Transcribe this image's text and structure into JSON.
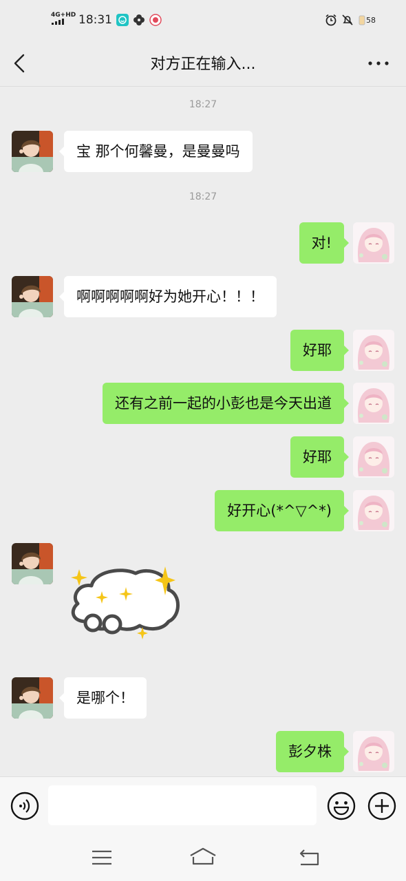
{
  "status_bar": {
    "network": "4G+HD",
    "time": "18:31",
    "battery": "58"
  },
  "header": {
    "title": "对方正在输入..."
  },
  "messages": [
    {
      "type": "time",
      "text": "18:27"
    },
    {
      "type": "text",
      "side": "in",
      "text": "宝 那个何馨曼，是曼曼吗"
    },
    {
      "type": "time",
      "text": "18:27"
    },
    {
      "type": "text",
      "side": "out",
      "text": "对!"
    },
    {
      "type": "text",
      "side": "in",
      "text": "啊啊啊啊啊好为她开心！！！"
    },
    {
      "type": "text",
      "side": "out",
      "text": "好耶"
    },
    {
      "type": "text",
      "side": "out",
      "text": "还有之前一起的小彭也是今天出道"
    },
    {
      "type": "text",
      "side": "out",
      "text": "好耶"
    },
    {
      "type": "text",
      "side": "out",
      "text": "好开心(*^▽^*)"
    },
    {
      "type": "sticker",
      "side": "in",
      "icon": "sparkle-cloud-sticker"
    },
    {
      "type": "text",
      "side": "in",
      "text": "是哪个！"
    },
    {
      "type": "text",
      "side": "out",
      "text": "彭夕株"
    }
  ],
  "input_bar": {
    "value": "",
    "voice_icon": "voice-icon",
    "emoji_icon": "emoji-icon",
    "plus_icon": "plus-icon"
  },
  "nav_bar": {
    "icons": [
      "menu-icon",
      "home-icon",
      "back-icon"
    ]
  },
  "colors": {
    "background": "#ededed",
    "incoming_bubble": "#ffffff",
    "outgoing_bubble": "#95ec69",
    "timestamp": "#9a9a9a"
  }
}
